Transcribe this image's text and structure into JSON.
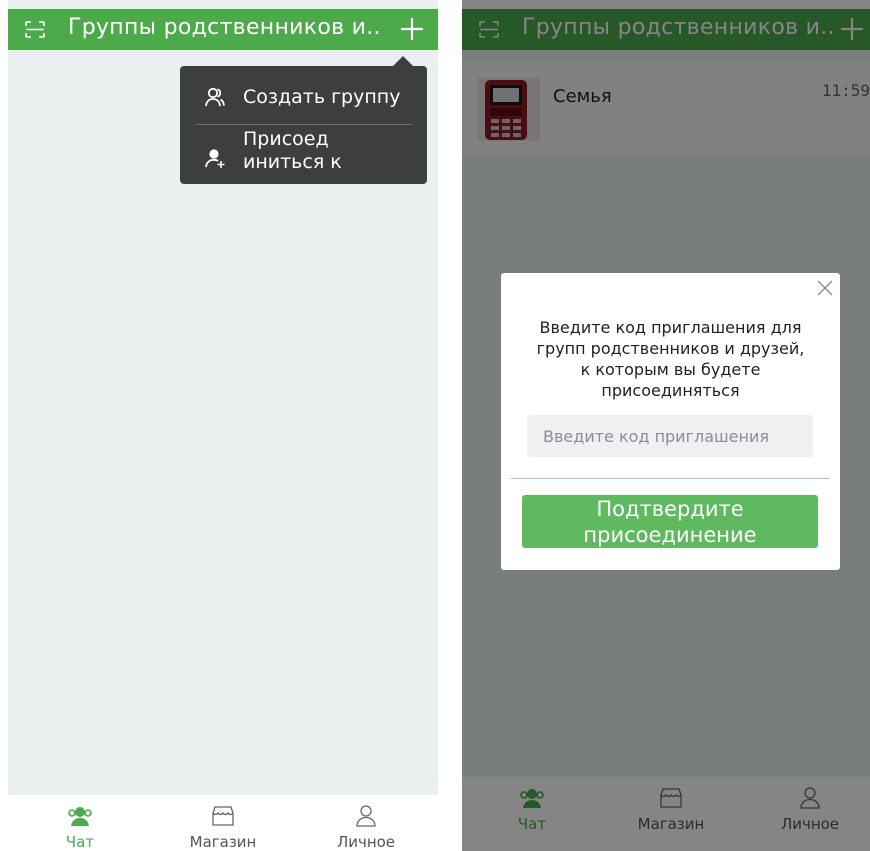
{
  "colors": {
    "brand_green": "#4caa4b",
    "menu_bg": "#3d3e40",
    "confirm_green": "#5fb95f"
  },
  "left": {
    "header": {
      "title": "Группы родственников и..",
      "scan_icon": "scan-icon",
      "add_icon": "plus-icon"
    },
    "menu": {
      "create_label": "Создать группу",
      "join_label": "Присоед иниться к"
    },
    "nav": [
      {
        "label": "Чат",
        "icon": "chat-people-icon",
        "active": true
      },
      {
        "label": "Магазин",
        "icon": "store-icon",
        "active": false
      },
      {
        "label": "Личное",
        "icon": "person-icon",
        "active": false
      }
    ]
  },
  "right": {
    "header": {
      "title": "Группы родственников и..",
      "scan_icon": "scan-icon",
      "add_icon": "plus-icon"
    },
    "chat": {
      "name": "Семья",
      "time": "11:59"
    },
    "modal": {
      "message": "Введите код приглашения для групп родственников и друзей, к которым вы будете присоединяться",
      "input_placeholder": "Введите код приглашения",
      "input_value": "",
      "confirm_label": "Подтвердите присоединение"
    },
    "nav": [
      {
        "label": "Чат",
        "icon": "chat-people-icon",
        "active": true
      },
      {
        "label": "Магазин",
        "icon": "store-icon",
        "active": false
      },
      {
        "label": "Личное",
        "icon": "person-icon",
        "active": false
      }
    ]
  }
}
